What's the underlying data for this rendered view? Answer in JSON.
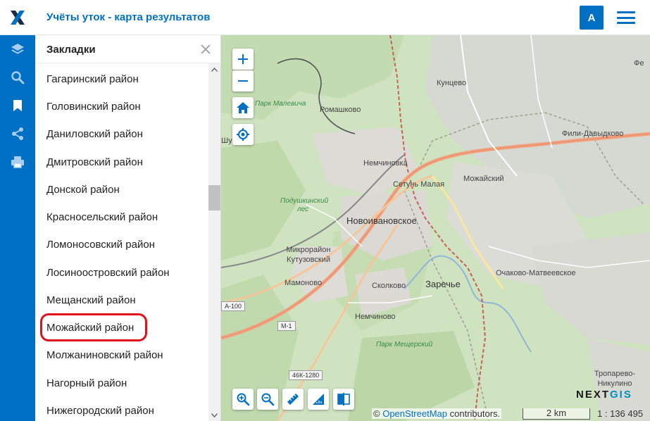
{
  "header": {
    "title": "Учёты уток - карта результатов",
    "avatar_letter": "A"
  },
  "panel": {
    "title": "Закладки",
    "items": [
      "Гагаринский район",
      "Головинский район",
      "Даниловский район",
      "Дмитровский район",
      "Донской район",
      "Красносельский район",
      "Ломоносовский район",
      "Лосиноостровский район",
      "Мещанский район",
      "Можайский район",
      "Молжаниновский район",
      "Нагорный район",
      "Нижегородский район"
    ],
    "highlighted_item": "Можайский район"
  },
  "map": {
    "labels": {
      "kuntsevo": "Кунцево",
      "fili": "Фили-Давыдково",
      "park_malevicha": "Парк Малевича",
      "romashkovo": "Ромашково",
      "nemchinovka": "Немчиновка",
      "setun": "Сетунь Малая",
      "mozhaysky": "Можайский",
      "podushkinsky": "Подушкинский лес",
      "novoivanovskoe": "Новоивановское",
      "mikrorayon": "Микрорайон Кутузовский",
      "mamonovo": "Мамоново",
      "skolkovo": "Сколково",
      "zarechye": "Заречье",
      "ochakovo": "Очаково-Матвеевское",
      "nemchinovo": "Немчиново",
      "park_meshchersky": "Парк Мещерский",
      "troparevo": "Тропарево-Никулино",
      "shul": "Шул",
      "fe": "Фе"
    },
    "shields": {
      "a100": "А-100",
      "m1": "М-1",
      "k46": "46К-1280"
    },
    "attribution_prefix": "©",
    "attribution_link": "OpenStreetMap",
    "attribution_suffix": "contributors.",
    "scale_label": "2 km",
    "scale_ratio": "1 : 136 495",
    "brand_next": "NEXT",
    "brand_gis": "GIS"
  },
  "colors": {
    "accent": "#0070c5",
    "highlight": "#e0101a",
    "forest": "#c8dfb8",
    "urban": "#dedcd8"
  },
  "icons": {
    "logo": "nextgis-x-logo",
    "tools": [
      "layers-icon",
      "search-icon",
      "bookmark-icon",
      "share-icon",
      "print-icon"
    ]
  }
}
